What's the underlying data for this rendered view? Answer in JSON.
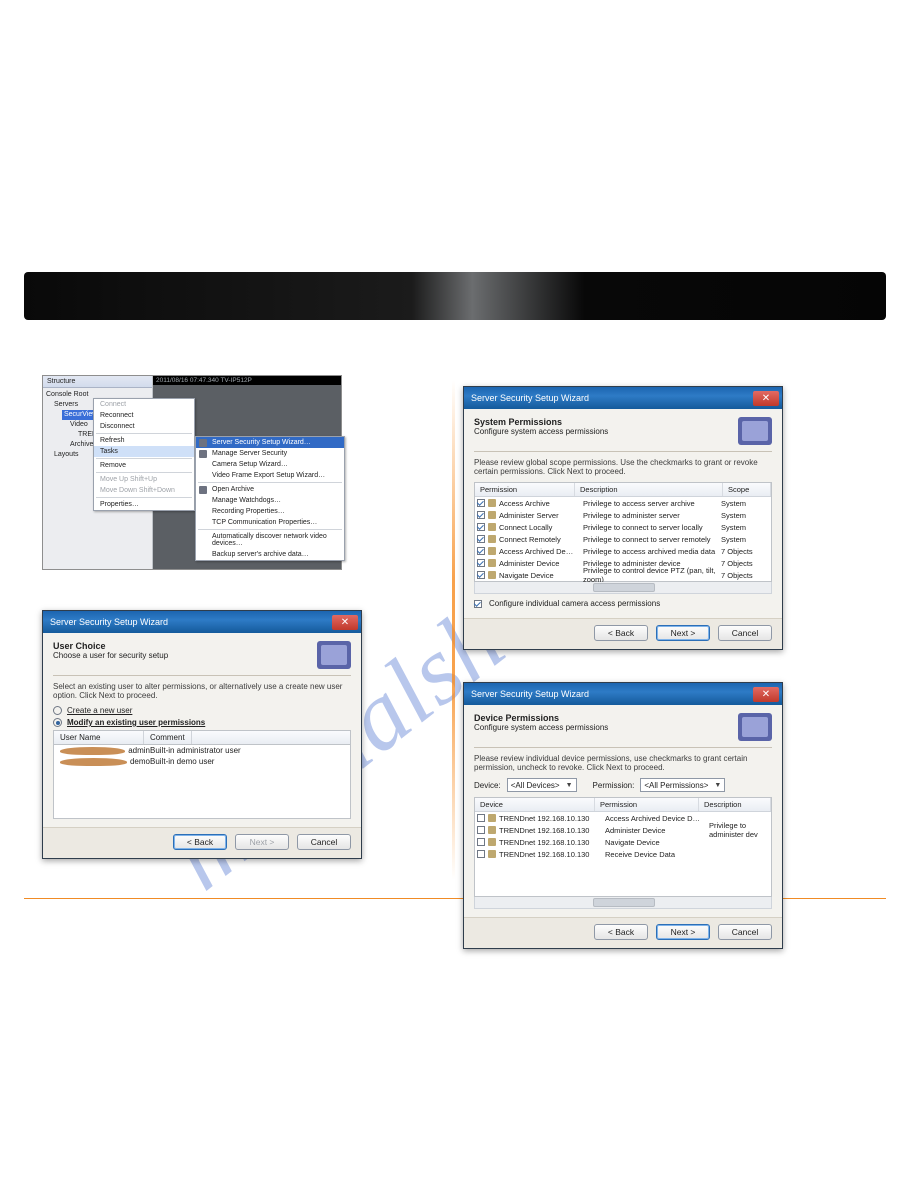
{
  "watermark": "manualshive.com",
  "section_title": " ",
  "shotA": {
    "structure_header": "Structure",
    "tree": {
      "root": "Console Root",
      "servers": "Servers",
      "server_sel": "SecurView Pro",
      "video": "Video",
      "trend": "TRENDnet",
      "archive": "Archive",
      "layouts": "Layouts"
    },
    "video_bar": "2011/08/16 07:47.340  TV-IP512P",
    "ctx": {
      "connect": "Connect",
      "reconnect": "Reconnect",
      "disconnect": "Disconnect",
      "refresh": "Refresh",
      "tasks": "Tasks",
      "remove": "Remove",
      "moveup": "Move Up        Shift+Up",
      "movedown": "Move Down   Shift+Down",
      "properties": "Properties…"
    },
    "sub": {
      "s1": "Server Security Setup Wizard…",
      "s2": "Manage Server Security",
      "s3": "Camera Setup Wizard…",
      "s4": "Video Frame Export Setup Wizard…",
      "s5": "Open Archive",
      "s6": "Manage Watchdogs…",
      "s7": "Recording Properties…",
      "s8": "TCP Communication Properties…",
      "s9": "Automatically discover network video devices…",
      "s10": "Backup server's archive data…"
    }
  },
  "shotB": {
    "title": "Server Security Setup Wizard",
    "heading": "User Choice",
    "sub": "Choose a user for security setup",
    "note": "Select an existing user to alter permissions, or alternatively use a create new user option. Click Next to proceed.",
    "opt_create": "Create a new user",
    "opt_modify": "Modify an existing user permissions",
    "col_user": "User Name",
    "col_comment": "Comment",
    "rows": [
      {
        "user": "admin",
        "comment": "Built-in administrator user"
      },
      {
        "user": "demo",
        "comment": "Built-in demo user"
      }
    ],
    "back": "< Back",
    "next": "Next >",
    "cancel": "Cancel"
  },
  "shotC": {
    "title": "Server Security Setup Wizard",
    "heading": "System Permissions",
    "sub": "Configure system access permissions",
    "note": "Please review global scope permissions. Use the checkmarks to grant or revoke certain permissions. Click Next to proceed.",
    "cols": {
      "perm": "Permission",
      "desc": "Description",
      "scope": "Scope"
    },
    "rows": [
      {
        "cb": true,
        "p": "Access Archive",
        "d": "Privilege to access server archive",
        "s": "System"
      },
      {
        "cb": true,
        "p": "Administer Server",
        "d": "Privilege to administer server",
        "s": "System"
      },
      {
        "cb": true,
        "p": "Connect Locally",
        "d": "Privilege to connect to server locally",
        "s": "System"
      },
      {
        "cb": true,
        "p": "Connect Remotely",
        "d": "Privilege to connect to server remotely",
        "s": "System"
      },
      {
        "cb": true,
        "p": "Access Archived De…",
        "d": "Privilege to access archived media data",
        "s": "7 Objects"
      },
      {
        "cb": true,
        "p": "Administer Device",
        "d": "Privilege to administer device",
        "s": "7 Objects"
      },
      {
        "cb": true,
        "p": "Navigate Device",
        "d": "Privilege to control device PTZ (pan, tilt, zoom)",
        "s": "7 Objects"
      }
    ],
    "chk_individual": "Configure individual camera access permissions",
    "back": "< Back",
    "next": "Next >",
    "cancel": "Cancel"
  },
  "shotD": {
    "title": "Server Security Setup Wizard",
    "heading": "Device Permissions",
    "sub": "Configure system access permissions",
    "note": "Please review individual device permissions, use checkmarks to grant certain permission, uncheck to revoke. Click Next to proceed.",
    "device_lbl": "Device:",
    "device_val": "<All Devices>",
    "perm_lbl": "Permission:",
    "perm_val": "<All Permissions>",
    "cols": {
      "dev": "Device",
      "perm": "Permission",
      "desc": "Description"
    },
    "rows": [
      {
        "d": "TRENDnet 192.168.10.130",
        "p": "Access Archived Device D…",
        "desc": ""
      },
      {
        "d": "TRENDnet 192.168.10.130",
        "p": "Administer Device",
        "desc": "Privilege to administer dev"
      },
      {
        "d": "TRENDnet 192.168.10.130",
        "p": "Navigate Device",
        "desc": ""
      },
      {
        "d": "TRENDnet 192.168.10.130",
        "p": "Receive Device Data",
        "desc": ""
      }
    ],
    "back": "< Back",
    "next": "Next >",
    "cancel": "Cancel"
  }
}
